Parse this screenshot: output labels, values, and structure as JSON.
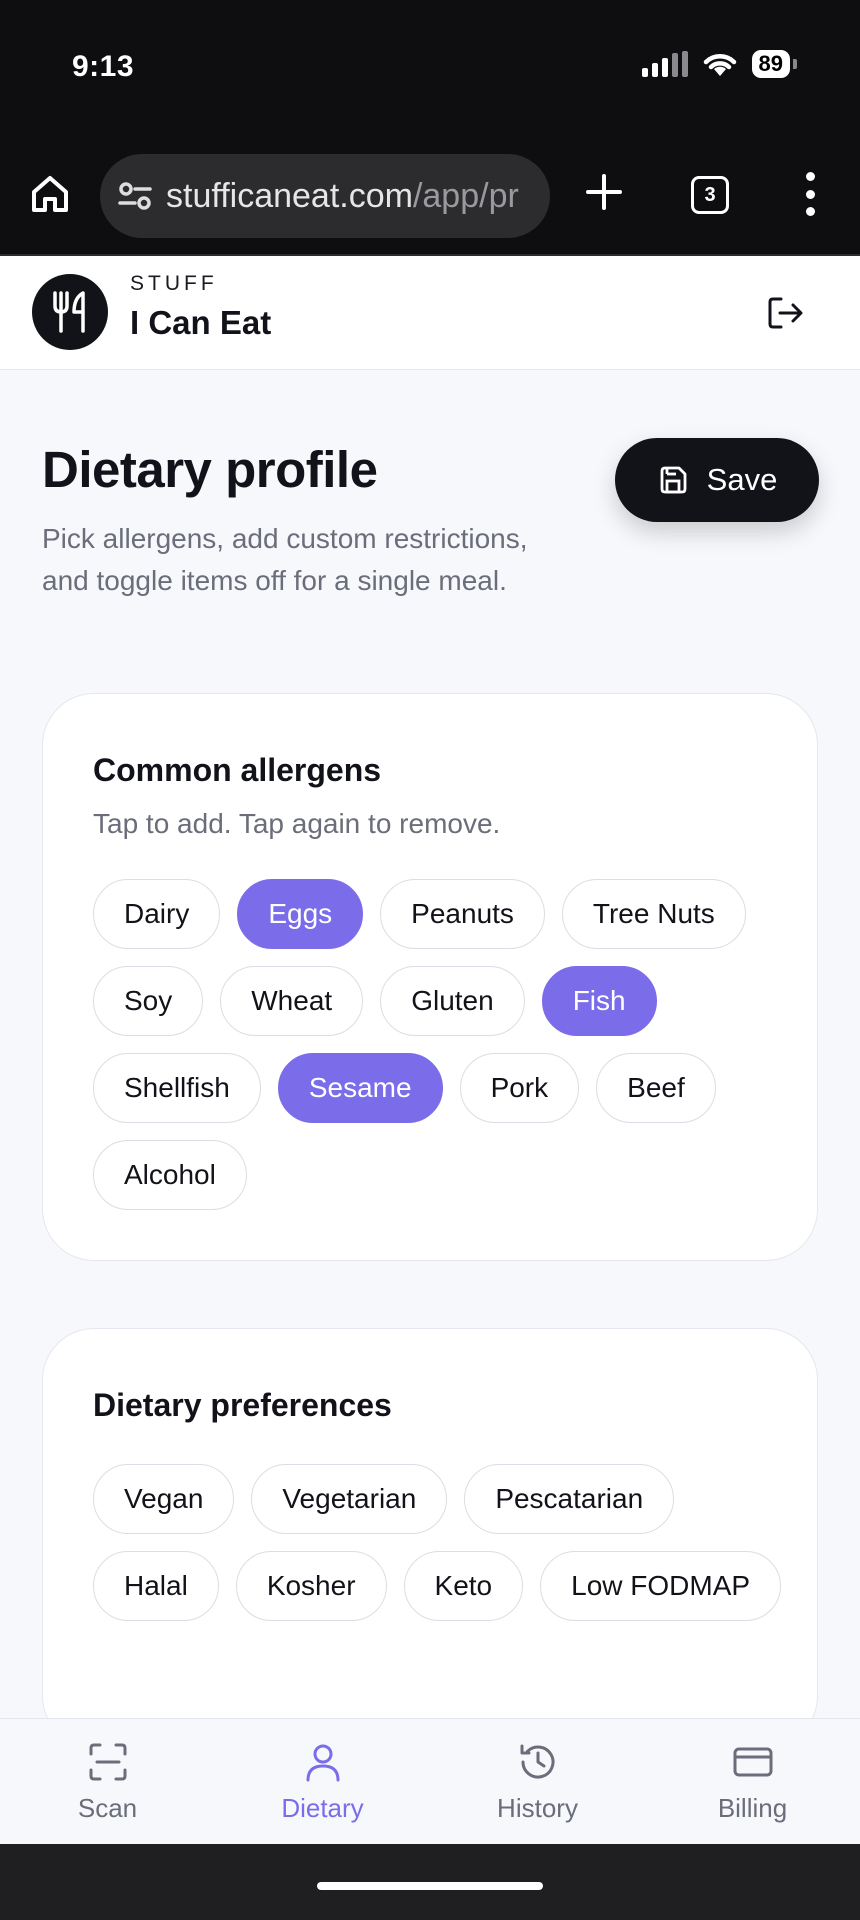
{
  "status_bar": {
    "time": "9:13",
    "battery": "89"
  },
  "browser": {
    "url_domain": "stufficaneat.com",
    "url_path": "/app/pr",
    "tab_count": "3"
  },
  "app_header": {
    "brand_small": "STUFF",
    "brand_name": "I Can Eat"
  },
  "page": {
    "title": "Dietary profile",
    "subtitle": "Pick allergens, add custom restrictions, and toggle items off for a single meal.",
    "save_label": "Save"
  },
  "allergens": {
    "title": "Common allergens",
    "hint": "Tap to add. Tap again to remove.",
    "items": [
      {
        "label": "Dairy",
        "selected": false
      },
      {
        "label": "Eggs",
        "selected": true
      },
      {
        "label": "Peanuts",
        "selected": false
      },
      {
        "label": "Tree Nuts",
        "selected": false
      },
      {
        "label": "Soy",
        "selected": false
      },
      {
        "label": "Wheat",
        "selected": false
      },
      {
        "label": "Gluten",
        "selected": false
      },
      {
        "label": "Fish",
        "selected": true
      },
      {
        "label": "Shellfish",
        "selected": false
      },
      {
        "label": "Sesame",
        "selected": true
      },
      {
        "label": "Pork",
        "selected": false
      },
      {
        "label": "Beef",
        "selected": false
      },
      {
        "label": "Alcohol",
        "selected": false
      }
    ]
  },
  "preferences": {
    "title": "Dietary preferences",
    "items": [
      {
        "label": "Vegan",
        "selected": false
      },
      {
        "label": "Vegetarian",
        "selected": false
      },
      {
        "label": "Pescatarian",
        "selected": false
      },
      {
        "label": "Halal",
        "selected": false
      },
      {
        "label": "Kosher",
        "selected": false
      },
      {
        "label": "Keto",
        "selected": false
      },
      {
        "label": "Low FODMAP",
        "selected": false
      }
    ]
  },
  "bottom_nav": {
    "active": "Dietary",
    "items": [
      {
        "label": "Scan",
        "icon": "scan-icon"
      },
      {
        "label": "Dietary",
        "icon": "person-icon"
      },
      {
        "label": "History",
        "icon": "history-icon"
      },
      {
        "label": "Billing",
        "icon": "credit-card-icon"
      }
    ]
  },
  "colors": {
    "accent": "#7b6cea",
    "dark": "#121219",
    "muted": "#6b6d7a"
  }
}
